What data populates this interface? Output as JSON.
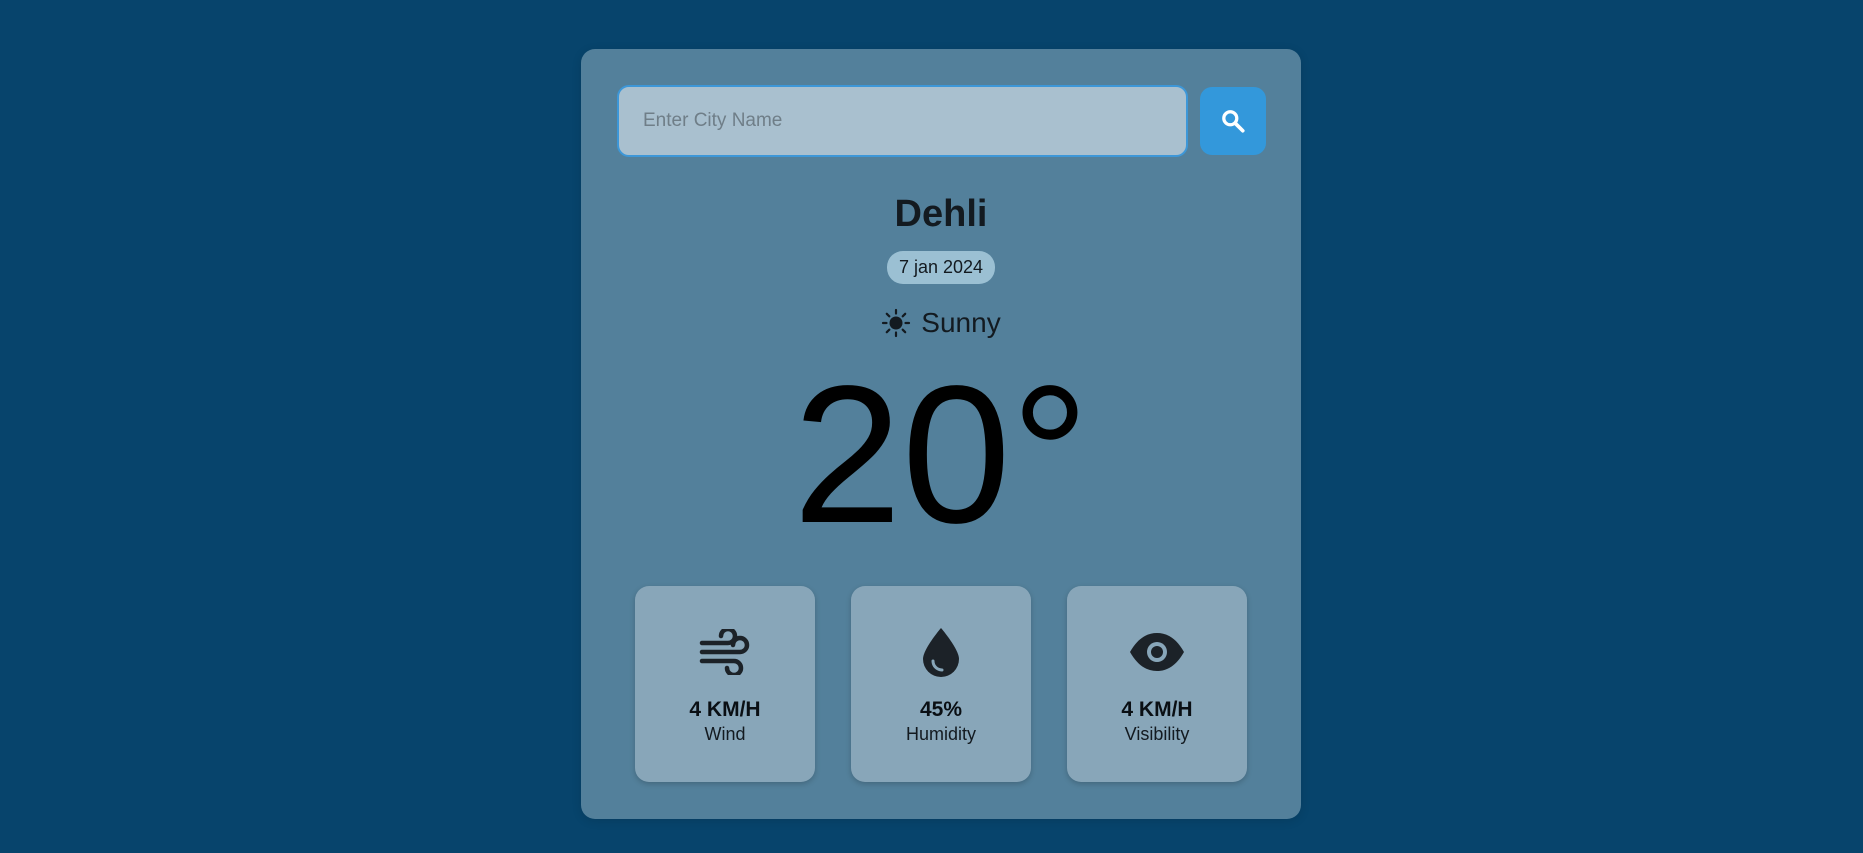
{
  "search": {
    "placeholder": "Enter City Name",
    "value": ""
  },
  "weather": {
    "city": "Dehli",
    "date": "7 jan 2024",
    "condition": "Sunny",
    "condition_icon": "sun-icon",
    "temperature": "20°"
  },
  "stats": [
    {
      "icon": "wind-icon",
      "value": "4 KM/H",
      "label": "Wind"
    },
    {
      "icon": "water-drop-icon",
      "value": "45%",
      "label": "Humidity"
    },
    {
      "icon": "eye-icon",
      "value": "4 KM/H",
      "label": "Visibility"
    }
  ],
  "colors": {
    "background": "#07446c",
    "card": "#53809b",
    "accent": "#3398db",
    "stat_card": "#88a6b9"
  }
}
